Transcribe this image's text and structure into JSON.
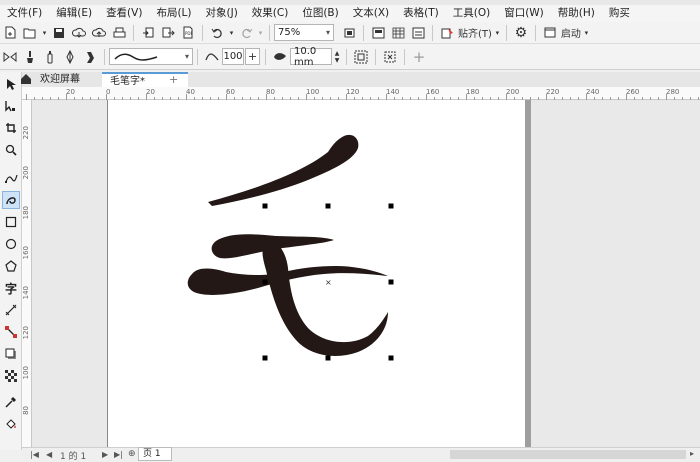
{
  "menubar": {
    "items": [
      "文件(F)",
      "编辑(E)",
      "查看(V)",
      "布局(L)",
      "对象(J)",
      "效果(C)",
      "位图(B)",
      "文本(X)",
      "表格(T)",
      "工具(O)",
      "窗口(W)",
      "帮助(H)",
      "购买"
    ]
  },
  "toolbar1": {
    "zoom_value": "75%",
    "snap_label": "贴齐(T)",
    "launch_label": "启动"
  },
  "toolbar2": {
    "smoothing_value": "100",
    "width_value": "10.0 mm"
  },
  "tabs": {
    "welcome_label": "欢迎屏幕",
    "document_label": "毛笔字*"
  },
  "ruler": {
    "h_labels": [
      "20",
      "0",
      "20",
      "40",
      "60",
      "80",
      "100",
      "120",
      "140",
      "160",
      "180",
      "200",
      "220",
      "240",
      "260",
      "280"
    ],
    "v_labels": [
      "220",
      "200",
      "180",
      "160",
      "140",
      "120",
      "100",
      "80"
    ]
  },
  "pagebar": {
    "page_of": "1 的 1",
    "page_tab": "页 1"
  },
  "colors": {
    "stroke_color": "#231815",
    "page_background": "#ffffff",
    "desktop_background": "#e9e9e9"
  }
}
